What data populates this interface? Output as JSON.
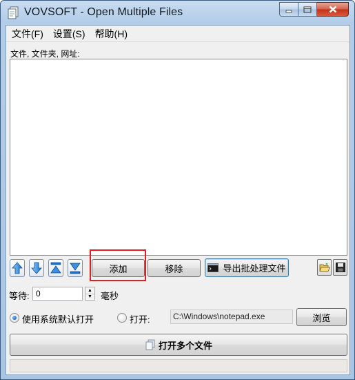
{
  "window": {
    "title": "VOVSOFT - Open Multiple Files"
  },
  "menu": {
    "items": [
      "文件(F)",
      "设置(S)",
      "帮助(H)"
    ]
  },
  "files_label": "文件, 文件夹, 网址:",
  "buttons": {
    "add": "添加",
    "remove": "移除",
    "export_batch": "导出批处理文件",
    "browse": "浏览",
    "open_multiple": "打开多个文件"
  },
  "wait": {
    "label": "等待:",
    "value": "0",
    "unit": "毫秒"
  },
  "open_mode": {
    "default_label": "使用系统默认打开",
    "open_with_label": "打开:",
    "open_with_path": "C:\\Windows\\notepad.exe",
    "selected": "default"
  },
  "icons": [
    "app-icon",
    "arrow-up-icon",
    "arrow-down-icon",
    "move-top-icon",
    "move-bottom-icon",
    "terminal-icon",
    "open-folder-icon",
    "save-icon",
    "files-icon"
  ],
  "colors": {
    "highlight": "#e02020",
    "accent": "#3c7fb1"
  }
}
